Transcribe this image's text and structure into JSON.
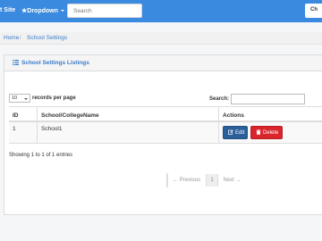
{
  "navbar": {
    "site_label": "t Site",
    "dropdown_label": "★Dropdown",
    "search_placeholder": "Search",
    "right_button_label": "Ch"
  },
  "breadcrumb": {
    "home": "Home",
    "separator": "/",
    "current": "School Settings"
  },
  "panel": {
    "title": "School Settings Listings",
    "length_value": "10",
    "length_label": "records per page",
    "search_label": "Search:",
    "table": {
      "headers": [
        "ID",
        "School/CollegeName",
        "Actions"
      ],
      "rows": [
        {
          "id": "1",
          "name": "School1",
          "edit_label": "Edit",
          "delete_label": "Delete"
        }
      ]
    },
    "info": "Showing 1 to 1 of 1 entries",
    "pagination": {
      "prev": "← Previous",
      "page": "1",
      "next": "Next →"
    }
  },
  "colors": {
    "navbar": "#3a8ae0",
    "link": "#3a7bc8",
    "edit_button": "#2b5f99",
    "delete_button": "#d9252b"
  }
}
